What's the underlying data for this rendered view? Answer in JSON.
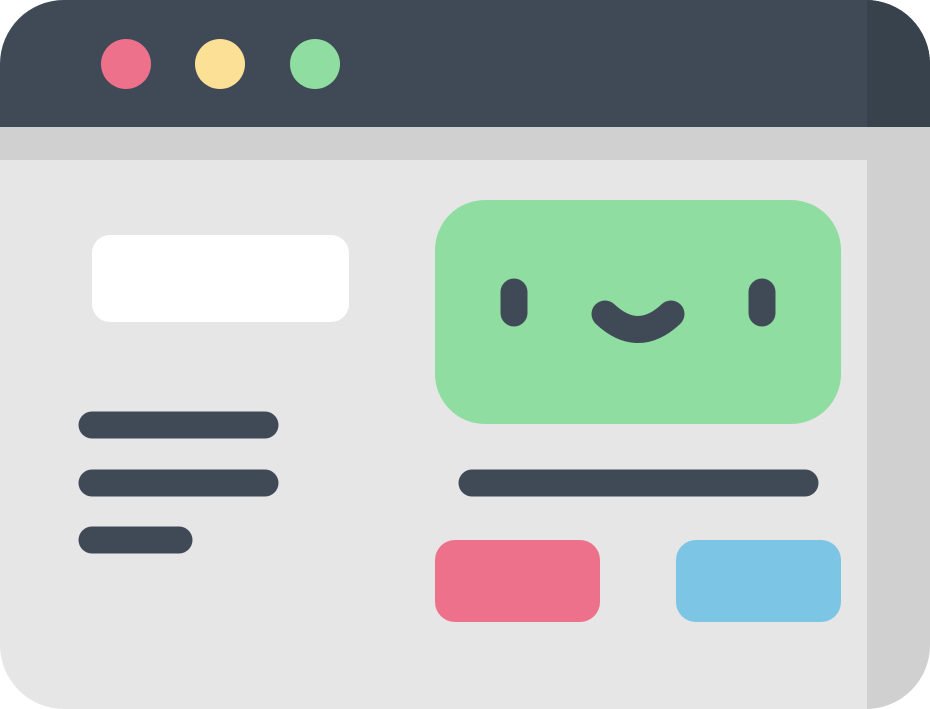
{
  "window": {
    "title_bar_color": "#3f4a56",
    "body_color": "#e6e6e6",
    "shadow_color": "#d0d0d0",
    "title_bar_dark_color": "#38424c",
    "controls": [
      {
        "name": "close",
        "color": "#ee718b"
      },
      {
        "name": "minimize",
        "color": "#fce096"
      },
      {
        "name": "maximize",
        "color": "#90dda2"
      }
    ]
  },
  "left_panel": {
    "input_box_color": "#ffffff",
    "text_lines": 3,
    "line_color": "#3f4a56"
  },
  "image_card": {
    "color": "#90dda2",
    "face_color": "#3f4a56",
    "expression": "smile"
  },
  "right_panel": {
    "caption_line_color": "#3f4a56",
    "buttons": [
      {
        "name": "primary",
        "color": "#ee718b"
      },
      {
        "name": "secondary",
        "color": "#7cc5e4"
      }
    ]
  }
}
